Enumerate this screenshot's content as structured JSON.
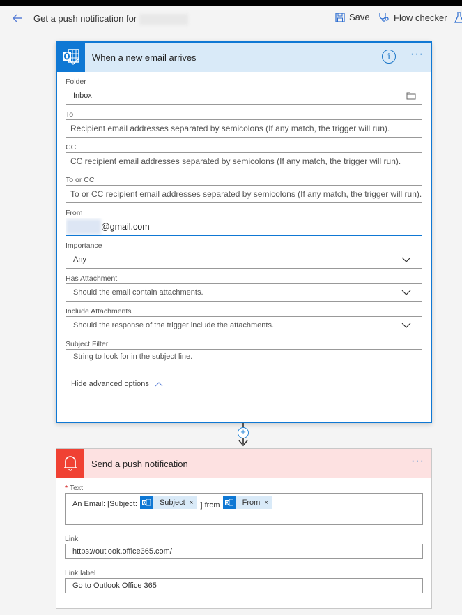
{
  "toolbar": {
    "title": "Get a push notification for",
    "save_label": "Save",
    "flow_checker_label": "Flow checker"
  },
  "trigger": {
    "title": "When a new email arrives",
    "fields": {
      "folder": {
        "label": "Folder",
        "value": "Inbox"
      },
      "to": {
        "label": "To",
        "placeholder": "Recipient email addresses separated by semicolons (If any match, the trigger will run)."
      },
      "cc": {
        "label": "CC",
        "placeholder": "CC recipient email addresses separated by semicolons (If any match, the trigger will run)."
      },
      "to_or_cc": {
        "label": "To or CC",
        "placeholder": "To or CC recipient email addresses separated by semicolons (If any match, the trigger will run)."
      },
      "from": {
        "label": "From",
        "value": "@gmail.com"
      },
      "importance": {
        "label": "Importance",
        "value": "Any"
      },
      "has_attachment": {
        "label": "Has Attachment",
        "placeholder": "Should the email contain attachments."
      },
      "include_attachments": {
        "label": "Include Attachments",
        "placeholder": "Should the response of the trigger include the attachments."
      },
      "subject_filter": {
        "label": "Subject Filter",
        "placeholder": "String to look for in the subject line."
      }
    },
    "hide_advanced_label": "Hide advanced options"
  },
  "action": {
    "title": "Send a push notification",
    "text_field": {
      "required_mark": "*",
      "label": "Text",
      "prefix": "An Email: [Subject:",
      "token1": "Subject",
      "middle": "] from",
      "token2": "From",
      "remove_glyph": "×"
    },
    "link": {
      "label": "Link",
      "value": "https://outlook.office365.com/"
    },
    "link_label": {
      "label": "Link label",
      "value": "Go to Outlook Office 365"
    }
  },
  "colors": {
    "outlook_blue": "#0f78d4",
    "trigger_header": "#d9eaf8",
    "notification_red": "#f04133",
    "action_header": "#fde1e1"
  }
}
